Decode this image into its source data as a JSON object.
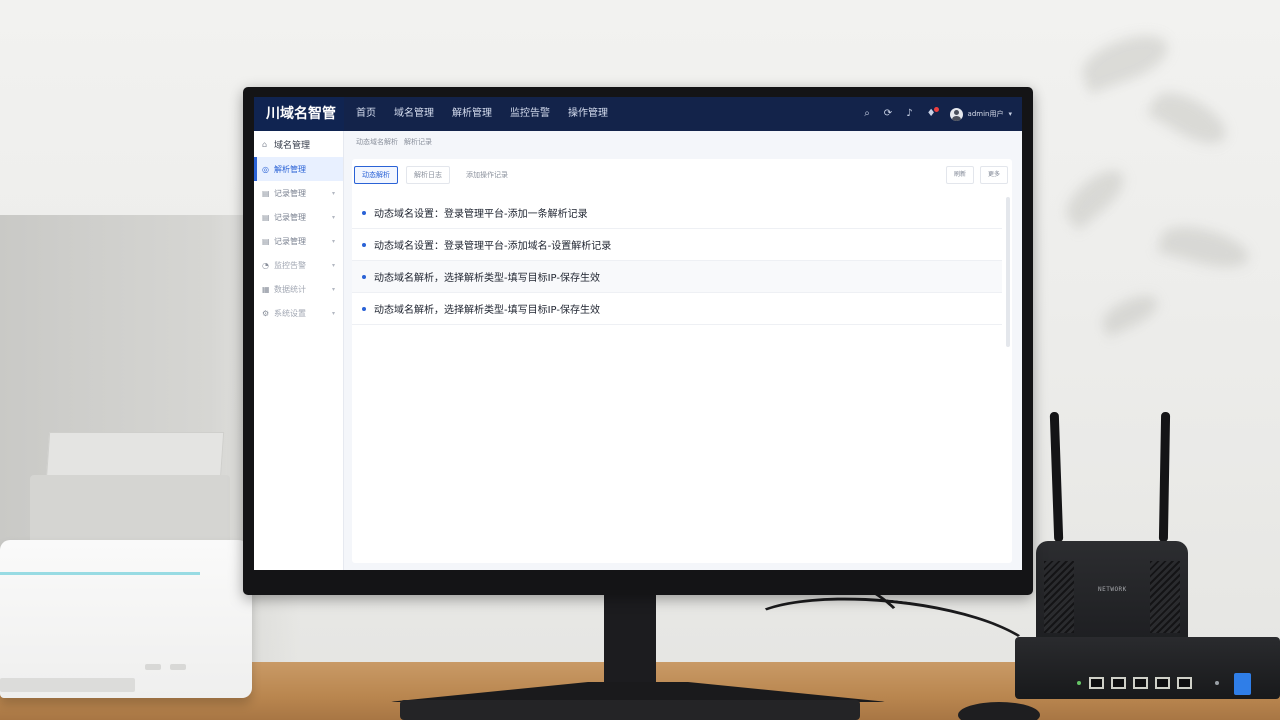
{
  "app": {
    "brand": "川域名智管"
  },
  "topnav": {
    "items": [
      "首页",
      "域名管理",
      "解析管理",
      "监控告警",
      "操作管理"
    ]
  },
  "user": {
    "name": "admin用户"
  },
  "sidebar": {
    "header": "域名管理",
    "items": [
      {
        "label": "解析管理",
        "icon": "globe-icon",
        "active": true
      },
      {
        "label": "记录管理",
        "icon": "list-icon"
      },
      {
        "label": "记录管理",
        "icon": "list-icon"
      },
      {
        "label": "记录管理",
        "icon": "list-icon"
      },
      {
        "label": "监控告警",
        "icon": "chart-icon"
      },
      {
        "label": "数据统计",
        "icon": "database-icon"
      },
      {
        "label": "系统设置",
        "icon": "gear-icon"
      }
    ]
  },
  "breadcrumb": {
    "items": [
      "动态域名解析",
      "解析记录"
    ]
  },
  "tabs": {
    "items": [
      "动态解析",
      "解析日志",
      "添加操作记录"
    ]
  },
  "actions": {
    "refresh": "刷新",
    "more": "更多"
  },
  "records": {
    "items": [
      "动态域名设置：登录管理平台-添加一条解析记录",
      "动态域名设置：登录管理平台-添加域名-设置解析记录",
      "动态域名解析，选择解析类型-填写目标IP-保存生效",
      "动态域名解析，选择解析类型-填写目标IP-保存生效"
    ]
  },
  "router": {
    "label": "NETWORK"
  },
  "colors": {
    "topbar": "#13234a",
    "accent": "#2a62d6",
    "alert": "#ee3f3f"
  }
}
